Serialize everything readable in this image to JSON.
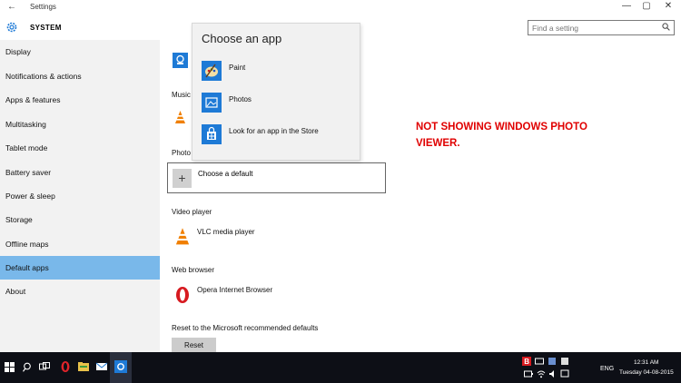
{
  "window": {
    "title": "Settings",
    "back_glyph": "←",
    "min_glyph": "—",
    "max_glyph": "▢",
    "close_glyph": "✕"
  },
  "header": {
    "section_title": "SYSTEM",
    "search_placeholder": "Find a setting"
  },
  "sidebar": {
    "items": [
      {
        "label": "Display"
      },
      {
        "label": "Notifications & actions"
      },
      {
        "label": "Apps & features"
      },
      {
        "label": "Multitasking"
      },
      {
        "label": "Tablet mode"
      },
      {
        "label": "Battery saver"
      },
      {
        "label": "Power & sleep"
      },
      {
        "label": "Storage"
      },
      {
        "label": "Offline maps"
      },
      {
        "label": "Default apps",
        "selected": true
      },
      {
        "label": "About"
      }
    ],
    "selected_color": "#79b8ea"
  },
  "content": {
    "music_label": "Music",
    "photo_label": "Photo",
    "choose_default": "Choose a default",
    "video_label": "Video player",
    "video_app": "VLC media player",
    "web_label": "Web browser",
    "web_app": "Opera Internet Browser",
    "reset_label": "Reset to the Microsoft recommended defaults",
    "reset_button": "Reset"
  },
  "popup": {
    "title": "Choose an app",
    "items": [
      {
        "label": "Paint",
        "icon": "paint-icon"
      },
      {
        "label": "Photos",
        "icon": "photos-icon"
      },
      {
        "label": "Look for an app in the Store",
        "icon": "store-icon"
      }
    ]
  },
  "annotation": {
    "line1": "NOT SHOWING WINDOWS PHOTO",
    "line2": "VIEWER."
  },
  "taskbar": {
    "language": "ENG",
    "time": "12:31 AM",
    "date": "Tuesday 04-08-2015"
  },
  "colors": {
    "accent": "#1e7ad6",
    "annotation": "#e00000",
    "taskbar": "#0d0f16"
  }
}
